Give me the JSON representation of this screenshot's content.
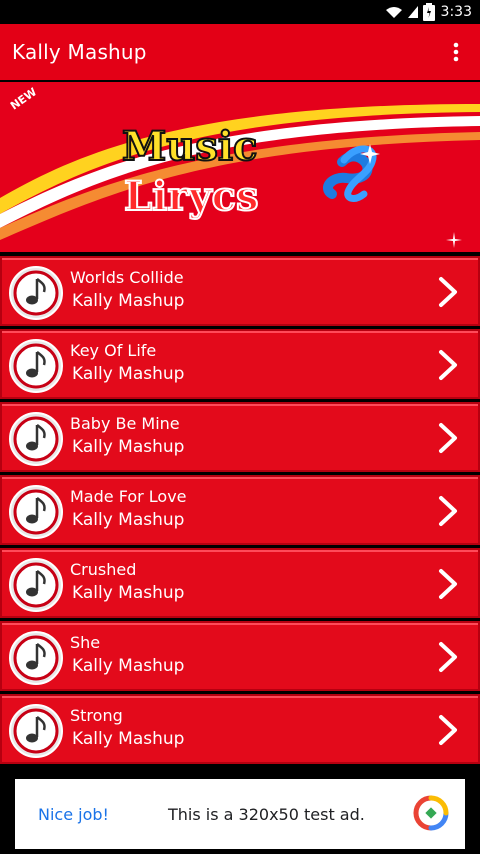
{
  "status_bar": {
    "time": "3:33"
  },
  "app_bar": {
    "title": "Kally Mashup"
  },
  "banner": {
    "badge": "NEW",
    "line1": "Music",
    "line2": "Lirycs"
  },
  "songs": [
    {
      "title": "Worlds Collide",
      "artist": "Kally Mashup"
    },
    {
      "title": "Key Of Life",
      "artist": "Kally Mashup"
    },
    {
      "title": "Baby Be Mine",
      "artist": "Kally Mashup"
    },
    {
      "title": "Made For Love",
      "artist": "Kally Mashup"
    },
    {
      "title": "Crushed",
      "artist": "Kally Mashup"
    },
    {
      "title": "She",
      "artist": "Kally Mashup"
    },
    {
      "title": "Strong",
      "artist": "Kally Mashup"
    }
  ],
  "ad": {
    "label": "Nice job!",
    "text": "This is a 320x50 test ad."
  },
  "colors": {
    "primary": "#e30016",
    "row_red": "#e30a1b",
    "ad_blue": "#1a73e8"
  },
  "icons": [
    "wifi-icon",
    "signal-icon",
    "battery-icon",
    "overflow-menu-icon",
    "music-note-icon",
    "chevron-right-icon",
    "ad-logo-icon"
  ]
}
